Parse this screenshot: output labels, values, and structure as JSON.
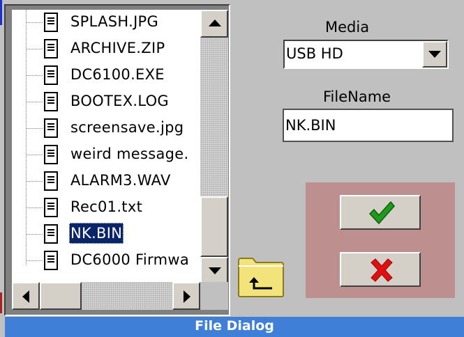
{
  "window": {
    "title": "File Dialog"
  },
  "files": [
    {
      "name": "SPLASH.JPG",
      "selected": false
    },
    {
      "name": "ARCHIVE.ZIP",
      "selected": false
    },
    {
      "name": "DC6100.EXE",
      "selected": false
    },
    {
      "name": "BOOTEX.LOG",
      "selected": false
    },
    {
      "name": "screensave.jpg",
      "selected": false
    },
    {
      "name": "weird message.",
      "selected": false
    },
    {
      "name": "ALARM3.WAV",
      "selected": false
    },
    {
      "name": "Rec01.txt",
      "selected": false
    },
    {
      "name": "NK.BIN",
      "selected": true
    },
    {
      "name": "DC6000 Firmwa",
      "selected": false
    }
  ],
  "media": {
    "label": "Media",
    "value": "USB HD"
  },
  "filename": {
    "label": "FileName",
    "value": "NK.BIN"
  },
  "icons": {
    "file": "document-icon",
    "folder_up": "folder-up-icon",
    "ok": "checkmark-icon",
    "cancel": "x-icon"
  },
  "colors": {
    "titlebar": "#3f7fd8",
    "selection": "#0a246a",
    "action_panel": "#be8f8f",
    "ok_icon": "#1f9a1f",
    "cancel_icon": "#e01010"
  }
}
